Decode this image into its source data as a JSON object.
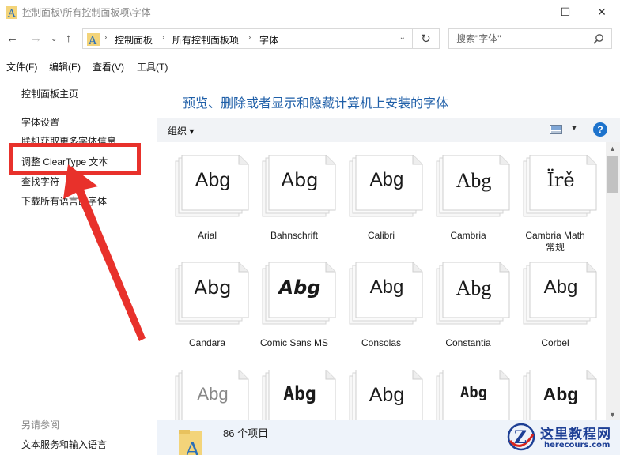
{
  "window": {
    "title": "控制面板\\所有控制面板项\\字体",
    "minimize": "—",
    "maximize": "☐",
    "close": "✕"
  },
  "nav": {
    "back": "←",
    "forward": "→",
    "recent": "⌄",
    "up": "↑",
    "breadcrumb": [
      "控制面板",
      "所有控制面板项",
      "字体"
    ],
    "refresh": "↻",
    "search_placeholder": "搜索\"字体\""
  },
  "menu": [
    "文件(F)",
    "编辑(E)",
    "查看(V)",
    "工具(T)"
  ],
  "sidebar": {
    "links": [
      "控制面板主页",
      "字体设置",
      "联机获取更多字体信息",
      "调整 ClearType 文本",
      "查找字符",
      "下载所有语言的字体"
    ],
    "see_also_title": "另请参阅",
    "see_also_links": [
      "文本服务和输入语言"
    ]
  },
  "main": {
    "heading": "预览、删除或者显示和隐藏计算机上安装的字体",
    "organize_label": "组织 ▾",
    "help": "?"
  },
  "fonts": [
    {
      "name": "Arial",
      "sample": "Abg"
    },
    {
      "name": "Bahnschrift",
      "sample": "Abg"
    },
    {
      "name": "Calibri",
      "sample": "Abg"
    },
    {
      "name": "Cambria",
      "sample": "Abg"
    },
    {
      "name": "Cambria Math\n常规",
      "sample": "Ïrě"
    },
    {
      "name": "Candara",
      "sample": "Abg"
    },
    {
      "name": "Comic Sans MS",
      "sample": "Abg"
    },
    {
      "name": "Consolas",
      "sample": "Abg"
    },
    {
      "name": "Constantia",
      "sample": "Abg"
    },
    {
      "name": "Corbel",
      "sample": "Abg"
    },
    {
      "name": "",
      "sample": "Abg"
    },
    {
      "name": "",
      "sample": "Abg"
    },
    {
      "name": "",
      "sample": "Abg"
    },
    {
      "name": "",
      "sample": "Abg"
    },
    {
      "name": "",
      "sample": "Abg"
    }
  ],
  "status": {
    "item_count": "86 个项目"
  },
  "watermark": {
    "name": "这里教程网",
    "url": "herecours.com"
  },
  "colors": {
    "accent_blue": "#1f5fa8",
    "annotation_red": "#e8312b",
    "details_bg": "#eef3fa"
  }
}
